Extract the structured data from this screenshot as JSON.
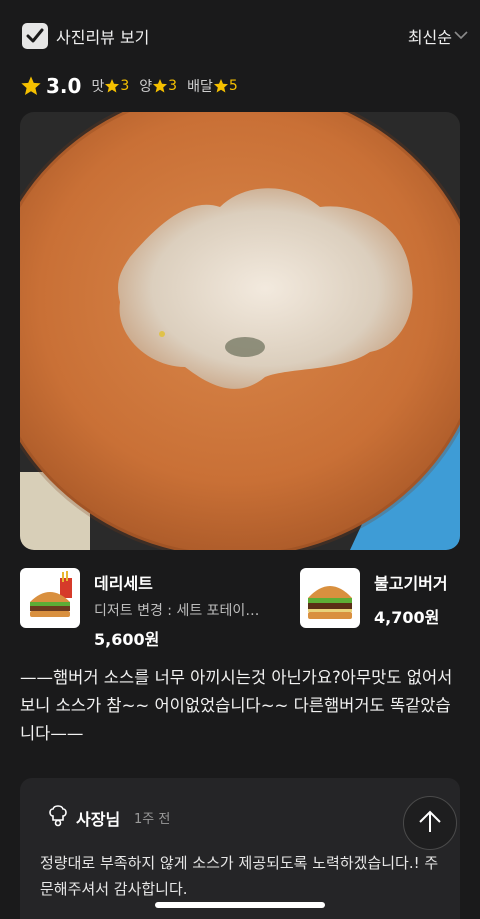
{
  "header": {
    "photo_review_label": "사진리뷰 보기",
    "photo_review_checked": true,
    "sort_label": "최신순"
  },
  "ratings": {
    "overall": "3.0",
    "taste_label": "맛",
    "taste_value": "3",
    "quantity_label": "양",
    "quantity_value": "3",
    "delivery_label": "배달",
    "delivery_value": "5"
  },
  "menus": [
    {
      "name": "데리세트",
      "option": "디저트 변경 : 세트 포테이…",
      "price": "5,600원"
    },
    {
      "name": "불고기버거",
      "option": "",
      "price": "4,700원"
    }
  ],
  "review": {
    "text": "——햄버거 소스를 너무 아끼시는것 아닌가요?아무맛도 없어서 보니 소스가 참~~ 어이없었습니다~~ 다른햄버거도 똑같았습니다——"
  },
  "owner_reply": {
    "author": "사장님",
    "time": "1주 전",
    "text": "정량대로 부족하지 않게 소스가 제공되도록 노력하겠습니다.! 주문해주셔서 감사합니다."
  },
  "colors": {
    "background": "#1a1a1b",
    "star": "#f5c000",
    "card": "#252527"
  }
}
